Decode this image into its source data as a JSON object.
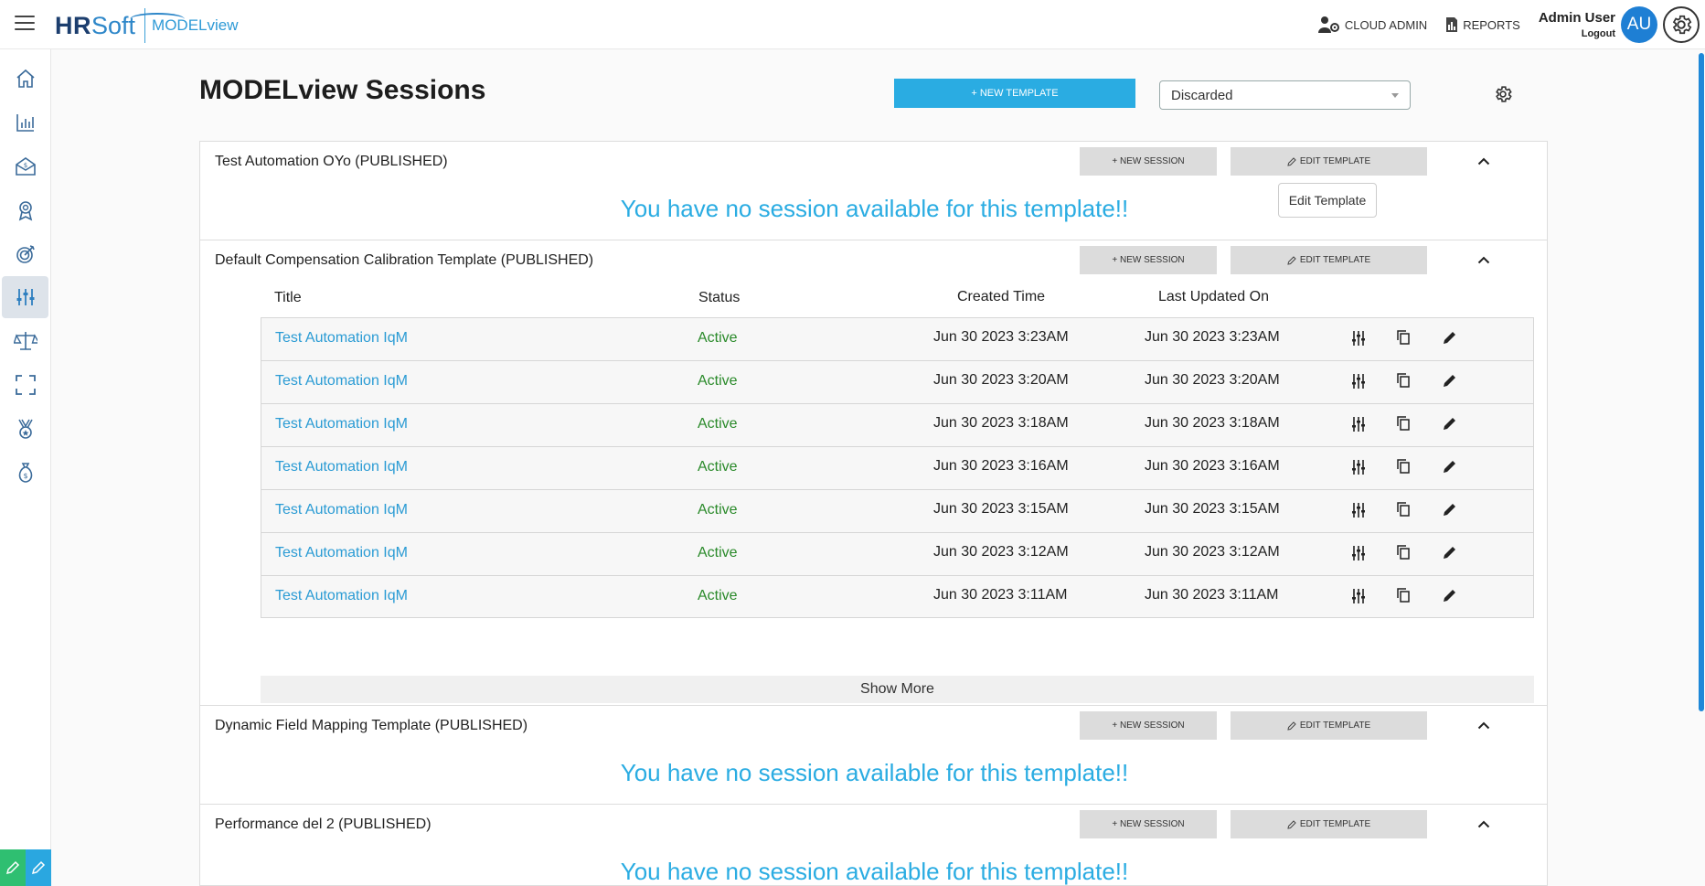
{
  "header": {
    "logo_hr": "HR",
    "logo_soft": "Soft",
    "app_name": "MODELview",
    "cloud_admin": "CLOUD ADMIN",
    "reports": "REPORTS",
    "user_name": "Admin User",
    "logout": "Logout",
    "avatar_initials": "AU"
  },
  "sidebar": {
    "items": [
      {
        "icon": "home-icon"
      },
      {
        "icon": "bar-chart-icon"
      },
      {
        "icon": "compensation-envelope-icon"
      },
      {
        "icon": "award-ribbon-icon"
      },
      {
        "icon": "target-icon"
      },
      {
        "icon": "sliders-icon",
        "active": true
      },
      {
        "icon": "balance-scale-icon"
      },
      {
        "icon": "expand-frame-icon"
      },
      {
        "icon": "medal-icon"
      },
      {
        "icon": "money-bag-icon"
      }
    ]
  },
  "page": {
    "title": "MODELview Sessions",
    "new_template_label": "+ NEW TEMPLATE",
    "filter_value": "Discarded"
  },
  "labels": {
    "new_session": "+ NEW SESSION",
    "edit_template": "EDIT TEMPLATE",
    "empty_message": "You have no session available for this template!!",
    "tooltip": "Edit Template",
    "show_more": "Show More"
  },
  "columns": {
    "title": "Title",
    "status": "Status",
    "created": "Created Time",
    "updated": "Last Updated On"
  },
  "templates": [
    {
      "name": "Test Automation OYo (PUBLISHED)"
    },
    {
      "name": "Default Compensation Calibration Template (PUBLISHED)",
      "sessions": [
        {
          "title": "Test Automation IqM",
          "status": "Active",
          "created": "Jun 30 2023 3:23AM",
          "updated": "Jun 30 2023 3:23AM"
        },
        {
          "title": "Test Automation IqM",
          "status": "Active",
          "created": "Jun 30 2023 3:20AM",
          "updated": "Jun 30 2023 3:20AM"
        },
        {
          "title": "Test Automation IqM",
          "status": "Active",
          "created": "Jun 30 2023 3:18AM",
          "updated": "Jun 30 2023 3:18AM"
        },
        {
          "title": "Test Automation IqM",
          "status": "Active",
          "created": "Jun 30 2023 3:16AM",
          "updated": "Jun 30 2023 3:16AM"
        },
        {
          "title": "Test Automation IqM",
          "status": "Active",
          "created": "Jun 30 2023 3:15AM",
          "updated": "Jun 30 2023 3:15AM"
        },
        {
          "title": "Test Automation IqM",
          "status": "Active",
          "created": "Jun 30 2023 3:12AM",
          "updated": "Jun 30 2023 3:12AM"
        },
        {
          "title": "Test Automation IqM",
          "status": "Active",
          "created": "Jun 30 2023 3:11AM",
          "updated": "Jun 30 2023 3:11AM"
        }
      ]
    },
    {
      "name": "Dynamic Field Mapping Template (PUBLISHED)"
    },
    {
      "name": "Performance del 2 (PUBLISHED)"
    }
  ],
  "colors": {
    "accent": "#2aace2",
    "link": "#2a9bd4",
    "status_active": "#2a8a2a",
    "avatar": "#1e7fd4"
  }
}
